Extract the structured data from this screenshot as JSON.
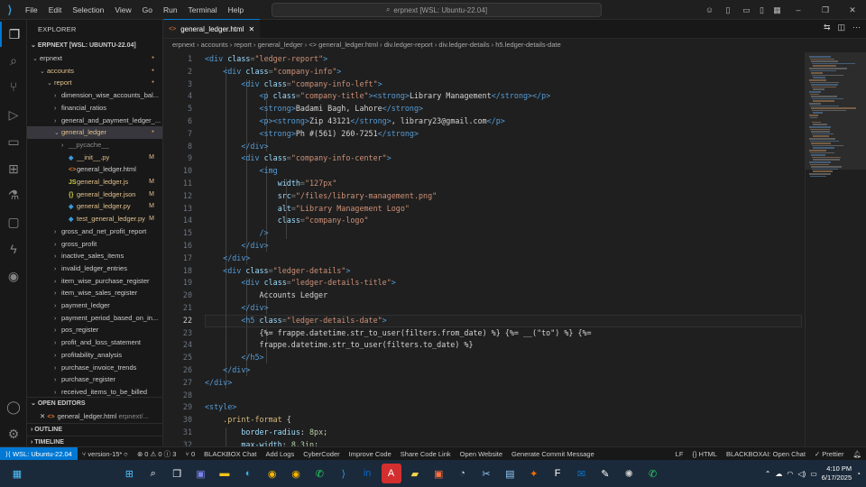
{
  "menu": [
    "File",
    "Edit",
    "Selection",
    "View",
    "Go",
    "Run",
    "Terminal",
    "Help"
  ],
  "search": {
    "text": "erpnext [WSL: Ubuntu-22.04]"
  },
  "sidebar": {
    "title": "EXPLORER",
    "root": "ERPNEXT [WSL: UBUNTU-22.04]",
    "items": [
      {
        "label": "erpnext",
        "indent": 1,
        "arrow": "⌄",
        "badge": "dot"
      },
      {
        "label": "accounts",
        "indent": 2,
        "arrow": "⌄",
        "badge": "dot",
        "mod": true
      },
      {
        "label": "report",
        "indent": 3,
        "arrow": "⌄",
        "badge": "dot",
        "mod": true
      },
      {
        "label": "dimension_wise_accounts_bal...",
        "indent": 4,
        "arrow": "›"
      },
      {
        "label": "financial_ratios",
        "indent": 4,
        "arrow": "›"
      },
      {
        "label": "general_and_payment_ledger_...",
        "indent": 4,
        "arrow": "›"
      },
      {
        "label": "general_ledger",
        "indent": 4,
        "arrow": "⌄",
        "badge": "dot",
        "mod": true,
        "selected": true
      },
      {
        "label": "__pycache__",
        "indent": 5,
        "arrow": "›",
        "dim": true
      },
      {
        "label": "__init__.py",
        "indent": 5,
        "icon": "◆",
        "iconColor": "#3b9ad8",
        "badge": "M",
        "mod": true
      },
      {
        "label": "general_ledger.html",
        "indent": 5,
        "icon": "<>",
        "iconColor": "#e37933"
      },
      {
        "label": "general_ledger.js",
        "indent": 5,
        "icon": "JS",
        "iconColor": "#cbcb41",
        "badge": "M",
        "mod": true
      },
      {
        "label": "general_ledger.json",
        "indent": 5,
        "icon": "{}",
        "iconColor": "#cbcb41",
        "badge": "M",
        "mod": true
      },
      {
        "label": "general_ledger.py",
        "indent": 5,
        "icon": "◆",
        "iconColor": "#3b9ad8",
        "badge": "M",
        "mod": true
      },
      {
        "label": "test_general_ledger.py",
        "indent": 5,
        "icon": "◆",
        "iconColor": "#3b9ad8",
        "badge": "M",
        "mod": true
      },
      {
        "label": "gross_and_net_profit_report",
        "indent": 4,
        "arrow": "›"
      },
      {
        "label": "gross_profit",
        "indent": 4,
        "arrow": "›"
      },
      {
        "label": "inactive_sales_items",
        "indent": 4,
        "arrow": "›"
      },
      {
        "label": "invalid_ledger_entries",
        "indent": 4,
        "arrow": "›"
      },
      {
        "label": "item_wise_purchase_register",
        "indent": 4,
        "arrow": "›"
      },
      {
        "label": "item_wise_sales_register",
        "indent": 4,
        "arrow": "›"
      },
      {
        "label": "payment_ledger",
        "indent": 4,
        "arrow": "›"
      },
      {
        "label": "payment_period_based_on_in...",
        "indent": 4,
        "arrow": "›"
      },
      {
        "label": "pos_register",
        "indent": 4,
        "arrow": "›"
      },
      {
        "label": "profit_and_loss_statement",
        "indent": 4,
        "arrow": "›"
      },
      {
        "label": "profitability_analysis",
        "indent": 4,
        "arrow": "›"
      },
      {
        "label": "purchase_invoice_trends",
        "indent": 4,
        "arrow": "›"
      },
      {
        "label": "purchase_register",
        "indent": 4,
        "arrow": "›"
      },
      {
        "label": "received_items_to_be_billed",
        "indent": 4,
        "arrow": "›"
      }
    ],
    "open_editors_title": "OPEN EDITORS",
    "open_editor_file": "general_ledger.html",
    "open_editor_path": "erpnext/...",
    "outline_title": "OUTLINE",
    "timeline_title": "TIMELINE"
  },
  "editor": {
    "tab_label": "general_ledger.html",
    "breadcrumb": "erpnext › accounts › report › general_ledger › <> general_ledger.html › div.ledger-report › div.ledger-details › h5.ledger-details-date",
    "current_line": 22,
    "lines": [
      [
        [
          "tg",
          "<div "
        ],
        [
          "at",
          "class"
        ],
        [
          "pu",
          "="
        ],
        [
          "st",
          "\"ledger-report\""
        ],
        [
          "tg",
          ">"
        ]
      ],
      [
        [
          "tx",
          "    "
        ],
        [
          "tg",
          "<div "
        ],
        [
          "at",
          "class"
        ],
        [
          "pu",
          "="
        ],
        [
          "st",
          "\"company-info\""
        ],
        [
          "tg",
          ">"
        ]
      ],
      [
        [
          "tx",
          "        "
        ],
        [
          "tg",
          "<div "
        ],
        [
          "at",
          "class"
        ],
        [
          "pu",
          "="
        ],
        [
          "st",
          "\"company-info-left\""
        ],
        [
          "tg",
          ">"
        ]
      ],
      [
        [
          "tx",
          "            "
        ],
        [
          "tg",
          "<p "
        ],
        [
          "at",
          "class"
        ],
        [
          "pu",
          "="
        ],
        [
          "st",
          "\"company-title\""
        ],
        [
          "tg",
          "><strong>"
        ],
        [
          "tx",
          "Library Management"
        ],
        [
          "tg",
          "</strong></p>"
        ]
      ],
      [
        [
          "tx",
          "            "
        ],
        [
          "tg",
          "<strong>"
        ],
        [
          "tx",
          "Badami Bagh, Lahore"
        ],
        [
          "tg",
          "</strong>"
        ]
      ],
      [
        [
          "tx",
          "            "
        ],
        [
          "tg",
          "<p><strong>"
        ],
        [
          "tx",
          "Zip 43121"
        ],
        [
          "tg",
          "</strong>"
        ],
        [
          "tx",
          ", library23@gmail.com"
        ],
        [
          "tg",
          "</p>"
        ]
      ],
      [
        [
          "tx",
          "            "
        ],
        [
          "tg",
          "<strong>"
        ],
        [
          "tx",
          "Ph #(561) 260-7251"
        ],
        [
          "tg",
          "</strong>"
        ]
      ],
      [
        [
          "tx",
          "        "
        ],
        [
          "tg",
          "</div>"
        ]
      ],
      [
        [
          "tx",
          "        "
        ],
        [
          "tg",
          "<div "
        ],
        [
          "at",
          "class"
        ],
        [
          "pu",
          "="
        ],
        [
          "st",
          "\"company-info-center\""
        ],
        [
          "tg",
          ">"
        ]
      ],
      [
        [
          "tx",
          "            "
        ],
        [
          "tg",
          "<img"
        ]
      ],
      [
        [
          "tx",
          "                "
        ],
        [
          "at",
          "width"
        ],
        [
          "pu",
          "="
        ],
        [
          "st",
          "\"127px\""
        ]
      ],
      [
        [
          "tx",
          "                "
        ],
        [
          "at",
          "src"
        ],
        [
          "pu",
          "="
        ],
        [
          "st",
          "\"/files/library-management.png\""
        ]
      ],
      [
        [
          "tx",
          "                "
        ],
        [
          "at",
          "alt"
        ],
        [
          "pu",
          "="
        ],
        [
          "st",
          "\"Library Management Logo\""
        ]
      ],
      [
        [
          "tx",
          "                "
        ],
        [
          "at",
          "class"
        ],
        [
          "pu",
          "="
        ],
        [
          "st",
          "\"company-logo\""
        ]
      ],
      [
        [
          "tx",
          "            "
        ],
        [
          "tg",
          "/>"
        ]
      ],
      [
        [
          "tx",
          "        "
        ],
        [
          "tg",
          "</div>"
        ]
      ],
      [
        [
          "tx",
          "    "
        ],
        [
          "tg",
          "</div>"
        ]
      ],
      [
        [
          "tx",
          "    "
        ],
        [
          "tg",
          "<div "
        ],
        [
          "at",
          "class"
        ],
        [
          "pu",
          "="
        ],
        [
          "st",
          "\"ledger-details\""
        ],
        [
          "tg",
          ">"
        ]
      ],
      [
        [
          "tx",
          "        "
        ],
        [
          "tg",
          "<div "
        ],
        [
          "at",
          "class"
        ],
        [
          "pu",
          "="
        ],
        [
          "st",
          "\"ledger-details-title\""
        ],
        [
          "tg",
          ">"
        ]
      ],
      [
        [
          "tx",
          "            Accounts Ledger"
        ]
      ],
      [
        [
          "tx",
          "        "
        ],
        [
          "tg",
          "</div>"
        ]
      ],
      [
        [
          "tx",
          "        "
        ],
        [
          "tg",
          "<h5 "
        ],
        [
          "at",
          "class"
        ],
        [
          "pu",
          "="
        ],
        [
          "st",
          "\"ledger-details-date\""
        ],
        [
          "tg",
          ">"
        ]
      ],
      [
        [
          "tx",
          "            {%= frappe.datetime.str_to_user(filters.from_date) %} {%= __(\"to\") %} {%="
        ]
      ],
      [
        [
          "tx",
          "            frappe.datetime.str_to_user(filters.to_date) %}"
        ]
      ],
      [
        [
          "tx",
          "        "
        ],
        [
          "tg",
          "</h5>"
        ]
      ],
      [
        [
          "tx",
          "    "
        ],
        [
          "tg",
          "</div>"
        ]
      ],
      [
        [
          "tg",
          "</div>"
        ]
      ],
      [
        [
          "tx",
          ""
        ]
      ],
      [
        [
          "tg",
          "<style>"
        ]
      ],
      [
        [
          "tx",
          "    "
        ],
        [
          "sel2",
          ".print-format"
        ],
        [
          "tx",
          " {"
        ]
      ],
      [
        [
          "tx",
          "        "
        ],
        [
          "pr",
          "border-radius"
        ],
        [
          "tx",
          ": "
        ],
        [
          "nu",
          "8px"
        ],
        [
          "tx",
          ";"
        ]
      ],
      [
        [
          "tx",
          "        "
        ],
        [
          "pr",
          "max-width"
        ],
        [
          "tx",
          ": "
        ],
        [
          "nu",
          "8.3in"
        ],
        [
          "tx",
          ";"
        ]
      ]
    ]
  },
  "status": {
    "remote": "WSL: Ubuntu-22.04",
    "branch": "version-15*",
    "problems": "⊗ 0 ⚠ 0 ⓘ 3",
    "ports": "⑂ 0",
    "left_items": [
      "BLACKBOX Chat",
      "Add Logs",
      "CyberCoder",
      "Improve Code",
      "Share Code Link",
      "Open Website",
      "Generate Commit Message"
    ],
    "right_items": [
      "LF",
      "{} HTML",
      "BLACKBOXAI: Open Chat",
      "✓ Prettier"
    ]
  },
  "taskbar": {
    "time": "4:10 PM",
    "date": "6/17/2025"
  },
  "colors": {
    "accent": "#0078d4",
    "editor_bg": "#1f1f1f",
    "sidebar_bg": "#181818"
  }
}
